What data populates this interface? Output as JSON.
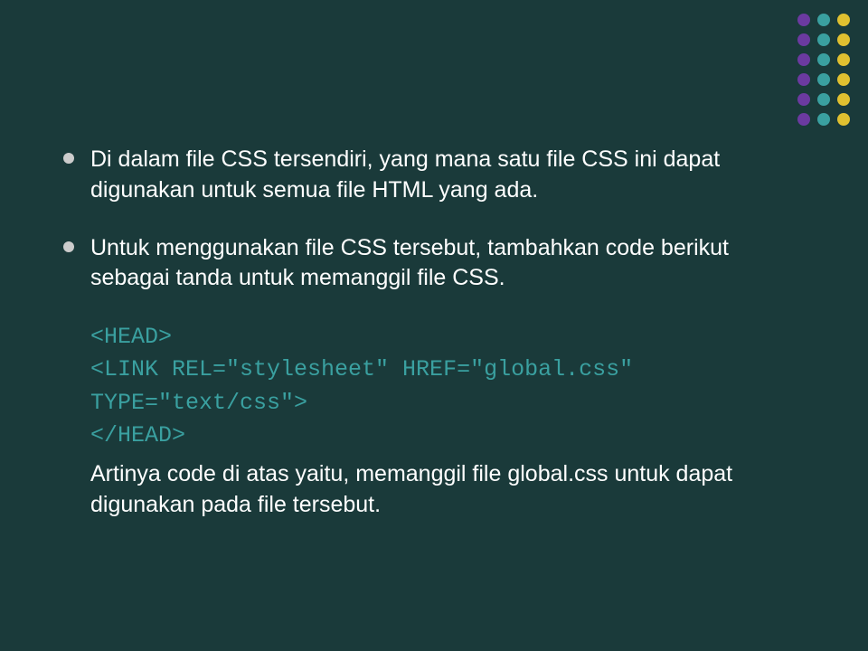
{
  "bullets": [
    "Di dalam file CSS tersendiri, yang mana satu file CSS ini dapat digunakan untuk semua file HTML yang ada.",
    "Untuk menggunakan file CSS tersebut, tambahkan code berikut sebagai tanda untuk memanggil file CSS."
  ],
  "code": {
    "line1": "<HEAD>",
    "line2": "<LINK REL=\"stylesheet\" HREF=\"global.css\"",
    "line3": "TYPE=\"text/css\">",
    "line4": "</HEAD>"
  },
  "explanation": "Artinya code di atas yaitu, memanggil file global.css untuk dapat digunakan pada file tersebut."
}
